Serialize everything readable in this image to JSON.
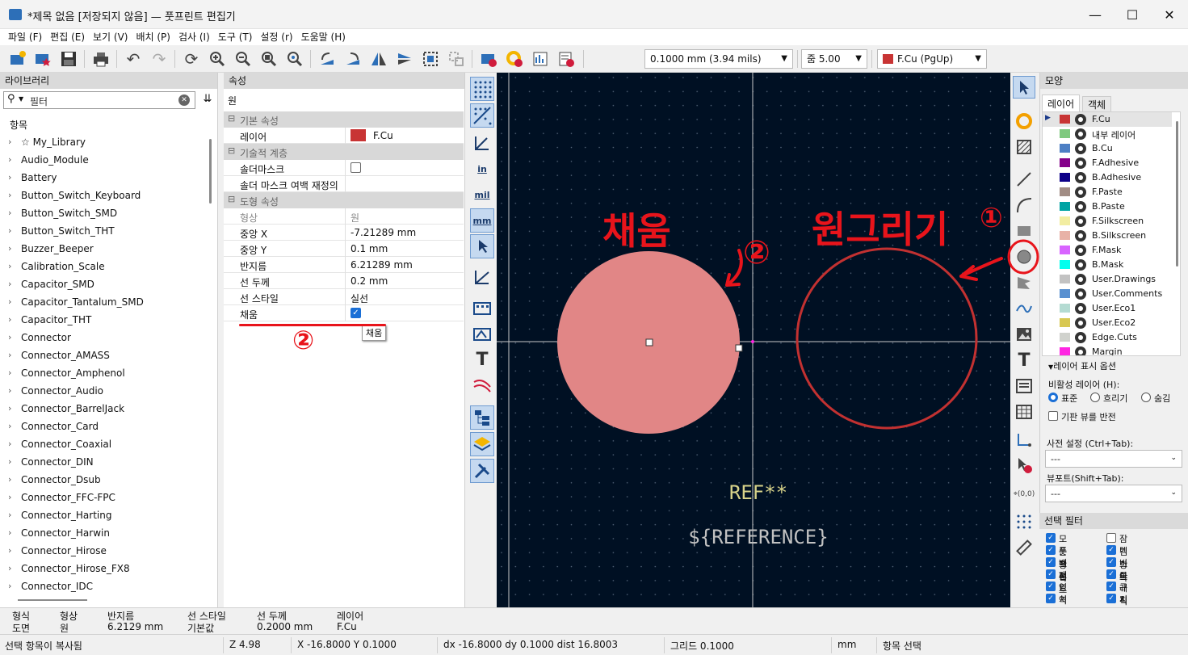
{
  "window": {
    "title": "*제목 없음 [저장되지 않음] — 풋프린트 편집기",
    "min": "—",
    "max": "☐",
    "close": "✕"
  },
  "menu": [
    "파일 (F)",
    "편집 (E)",
    "보기 (V)",
    "배치 (P)",
    "검사 (I)",
    "도구 (T)",
    "설정 (r)",
    "도움말 (H)"
  ],
  "toolbar": {
    "grid_value": "0.1000 mm (3.94 mils)",
    "zoom_value": "줌 5.00",
    "layer_value": "F.Cu (PgUp)",
    "layer_color": "#c83434"
  },
  "library": {
    "header": "라이브러리",
    "filter_placeholder": "필터",
    "column_header": "항목",
    "items": [
      "☆ My_Library",
      "Audio_Module",
      "Battery",
      "Button_Switch_Keyboard",
      "Button_Switch_SMD",
      "Button_Switch_THT",
      "Buzzer_Beeper",
      "Calibration_Scale",
      "Capacitor_SMD",
      "Capacitor_Tantalum_SMD",
      "Capacitor_THT",
      "Connector",
      "Connector_AMASS",
      "Connector_Amphenol",
      "Connector_Audio",
      "Connector_BarrelJack",
      "Connector_Card",
      "Connector_Coaxial",
      "Connector_DIN",
      "Connector_Dsub",
      "Connector_FFC-FPC",
      "Connector_Harting",
      "Connector_Harwin",
      "Connector_Hirose",
      "Connector_Hirose_FX8",
      "Connector_IDC"
    ]
  },
  "properties": {
    "header": "속성",
    "object": "원",
    "sec_basic": "기본 속성",
    "layer_key": "레이어",
    "layer_val": "F.Cu",
    "sec_tech": "기술적 계층",
    "solder_mask_key": "솔더마스크",
    "solder_margin_key": "솔더 마스크 여백 재정의",
    "sec_shape": "도형 속성",
    "shape_key": "형상",
    "shape_val": "원",
    "cx_key": "중앙 X",
    "cx_val": "-7.21289 mm",
    "cy_key": "중앙 Y",
    "cy_val": "0.1 mm",
    "radius_key": "반지름",
    "radius_val": "6.21289 mm",
    "width_key": "선 두께",
    "width_val": "0.2 mm",
    "style_key": "선 스타일",
    "style_val": "실선",
    "fill_key": "채움",
    "fill_tooltip": "채움"
  },
  "left_tools": {
    "in": "in",
    "mil": "mil",
    "mm": "mm"
  },
  "canvas": {
    "ref_text": "REF**",
    "reference_text": "${REFERENCE}",
    "annot_fill": "채움",
    "annot_circle": "원그리기",
    "annot_1": "①",
    "annot_2": "②"
  },
  "appearance": {
    "header": "모양",
    "tab_layers": "레이어",
    "tab_objects": "객체",
    "layers": [
      {
        "name": "F.Cu",
        "color": "#c83434"
      },
      {
        "name": "내부 레이어",
        "color": "#7fc97f"
      },
      {
        "name": "B.Cu",
        "color": "#4d7fc4"
      },
      {
        "name": "F.Adhesive",
        "color": "#84008a"
      },
      {
        "name": "B.Adhesive",
        "color": "#0d0088"
      },
      {
        "name": "F.Paste",
        "color": "#a18c84"
      },
      {
        "name": "B.Paste",
        "color": "#00a3a3"
      },
      {
        "name": "F.Silkscreen",
        "color": "#f2eda1"
      },
      {
        "name": "B.Silkscreen",
        "color": "#e8b2a7"
      },
      {
        "name": "F.Mask",
        "color": "#d864ff"
      },
      {
        "name": "B.Mask",
        "color": "#02ffee"
      },
      {
        "name": "User.Drawings",
        "color": "#c2c2c2"
      },
      {
        "name": "User.Comments",
        "color": "#5990d0"
      },
      {
        "name": "User.Eco1",
        "color": "#b4dbd2"
      },
      {
        "name": "User.Eco2",
        "color": "#d8c852"
      },
      {
        "name": "Edge.Cuts",
        "color": "#d0d2cd"
      },
      {
        "name": "Margin",
        "color": "#ff26e2"
      }
    ],
    "layer_options": "레이어 표시 옵션",
    "inactive_label": "비활성 레이어 (H):",
    "radio_normal": "표준",
    "radio_dim": "흐리기",
    "radio_hide": "숨김",
    "flip_board": "기판 뷰를 반전",
    "preset_label": "사전 설정 (Ctrl+Tab):",
    "preset_value": "---",
    "viewport_label": "뷰포트(Shift+Tab):",
    "viewport_value": "---"
  },
  "selection_filter": {
    "header": "선택 필터",
    "items": [
      {
        "label": "모든 항목",
        "checked": true
      },
      {
        "label": "잠긴 항목",
        "checked": false
      },
      {
        "label": "풋프린트",
        "checked": true
      },
      {
        "label": "텍스트",
        "checked": true
      },
      {
        "label": "배선",
        "checked": true
      },
      {
        "label": "비아",
        "checked": true
      },
      {
        "label": "패드",
        "checked": true
      },
      {
        "label": "그래픽",
        "checked": true
      },
      {
        "label": "영역",
        "checked": true
      },
      {
        "label": "규칙 영역",
        "checked": true
      },
      {
        "label": "치수",
        "checked": true
      },
      {
        "label": "기타 항목",
        "checked": true
      }
    ]
  },
  "message_panel": {
    "type_h": "형식",
    "type_v": "도면",
    "shape_h": "형상",
    "shape_v": "원",
    "radius_h": "반지름",
    "radius_v": "6.2129 mm",
    "style_h": "선 스타일",
    "style_v": "기본값",
    "width_h": "선 두께",
    "width_v": "0.2000 mm",
    "layer_h": "레이어",
    "layer_v": "F.Cu"
  },
  "status": {
    "message": "선택 항목이 복사됨",
    "z": "Z 4.98",
    "xy": "X -16.8000  Y 0.1000",
    "dxy": "dx -16.8000  dy 0.1000  dist 16.8003",
    "grid": "그리드 0.1000",
    "units": "mm",
    "mode": "항목 선택"
  }
}
